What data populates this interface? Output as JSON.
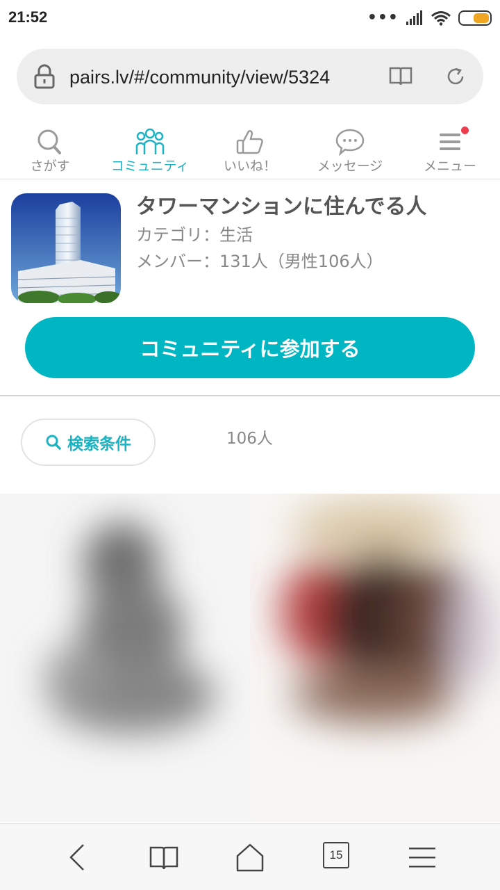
{
  "status_bar": {
    "time": "21:52",
    "icons": [
      "signal-dots-icon",
      "cell-signal-icon",
      "wifi-icon",
      "battery-icon"
    ],
    "signal_dots": "•••",
    "battery_color": "#f0a623"
  },
  "browser": {
    "url": "pairs.lv/#/community/view/5324",
    "icons": [
      "lock-icon",
      "reader-book-icon",
      "reload-icon"
    ]
  },
  "nav": {
    "items": [
      {
        "label": "さがす",
        "icon": "search-icon",
        "active": false
      },
      {
        "label": "コミュニティ",
        "icon": "community-people-icon",
        "active": true
      },
      {
        "label": "いいね！",
        "icon": "thumbs-up-icon",
        "active": false
      },
      {
        "label": "メッセージ",
        "icon": "message-bubble-icon",
        "active": false
      },
      {
        "label": "メニュー",
        "icon": "menu-icon",
        "active": false,
        "badge": true
      }
    ],
    "active_color": "#1ab3c4",
    "badge_color": "#ee3c4f"
  },
  "community": {
    "title": "タワーマンションに住んでる人",
    "category": "カテゴリ：生活",
    "members": "メンバー：131人（男性106人）",
    "thumbnail_icon": "tower-building-image",
    "join_label": "コミュニティに参加する",
    "join_color": "#00b6c2"
  },
  "search": {
    "label": "検索条件",
    "icon": "search-icon",
    "count": "106人"
  },
  "photos": [
    "blurred-profile-photo",
    "blurred-profile-photo"
  ],
  "toolbar": {
    "items": [
      "back-icon",
      "bookmarks-book-icon",
      "home-icon",
      "tabs-icon",
      "menu-icon"
    ],
    "tabs_count": "15"
  }
}
